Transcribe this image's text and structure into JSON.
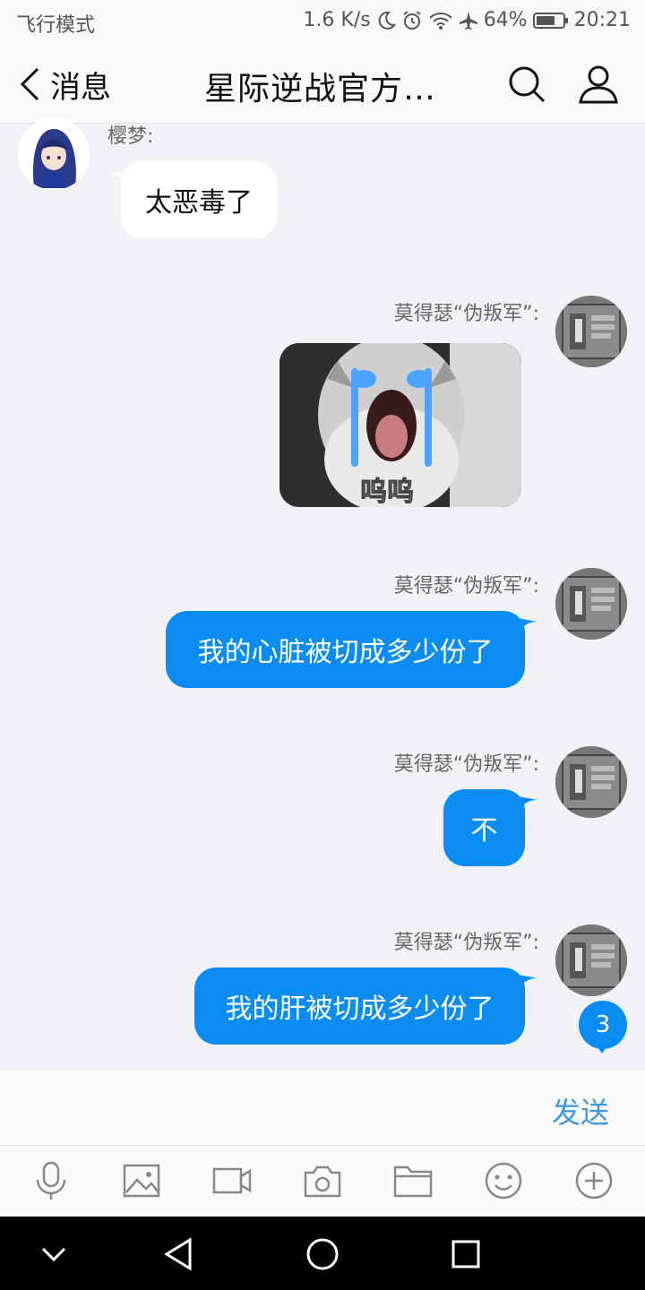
{
  "status_bar": {
    "mode": "飞行模式",
    "speed": "1.6 K/s",
    "battery": "64%",
    "time": "20:21",
    "icons": [
      "moon-icon",
      "alarm-icon",
      "wifi-icon",
      "airplane-icon",
      "battery-icon"
    ]
  },
  "header": {
    "back_label": "消息",
    "title": "星际逆战官方…",
    "icons": [
      "search-icon",
      "profile-icon"
    ]
  },
  "messages": [
    {
      "sender": "樱梦:",
      "direction": "incoming",
      "type": "text",
      "text": "太恶毒了"
    },
    {
      "sender": "莫得瑟“伪叛军”:",
      "direction": "outgoing",
      "type": "image",
      "image": "crying-cat-sticker",
      "sticker_text": "呜呜"
    },
    {
      "sender": "莫得瑟“伪叛军”:",
      "direction": "outgoing",
      "type": "text",
      "text": "我的心脏被切成多少份了"
    },
    {
      "sender": "莫得瑟“伪叛军”:",
      "direction": "outgoing",
      "type": "text",
      "text": "不"
    },
    {
      "sender": "莫得瑟“伪叛军”:",
      "direction": "outgoing",
      "type": "text",
      "text": "我的肝被切成多少份了"
    }
  ],
  "unread_count": "3",
  "input": {
    "value": "",
    "send_label": "发送"
  },
  "toolbar": [
    "microphone-icon",
    "image-icon",
    "video-icon",
    "camera-icon",
    "folder-icon",
    "emoji-icon",
    "plus-icon"
  ],
  "nav": [
    "collapse-icon",
    "back-icon",
    "home-icon",
    "recents-icon"
  ],
  "colors": {
    "accent": "#0a8cf0",
    "background": "#f0f2f5",
    "send": "#3a97e0"
  }
}
